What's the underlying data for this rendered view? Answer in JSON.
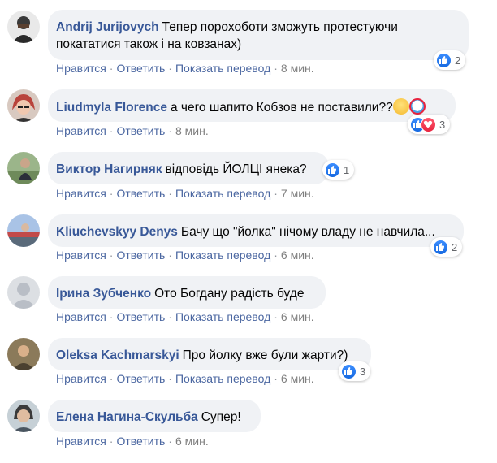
{
  "comments": [
    {
      "author": "Andrij Jurijovych",
      "lines": [
        "Тепер порохоботи зможуть протестуючи",
        "покататися також і на ковзанах)"
      ],
      "actions": {
        "like": "Нравится",
        "reply": "Ответить",
        "translate": "Показать перевод",
        "time": "8 мин."
      },
      "reactions": {
        "types": [
          "like"
        ],
        "count": "2"
      },
      "avatar_color": "#3a3a3a"
    },
    {
      "author": "Liudmyla Florence",
      "lines": [
        "а чего шапито Кобзов не поставили??"
      ],
      "emojis": [
        "worried-face",
        "clown-face"
      ],
      "actions": {
        "like": "Нравится",
        "reply": "Ответить",
        "time": "8 мин."
      },
      "reactions": {
        "types": [
          "like",
          "love"
        ],
        "count": "3"
      },
      "avatar_color": "#b9443c"
    },
    {
      "author": "Виктор Нагирняк",
      "lines": [
        "відповідь ЙОЛЦІ янека?"
      ],
      "actions": {
        "like": "Нравится",
        "reply": "Ответить",
        "translate": "Показать перевод",
        "time": "7 мин."
      },
      "reactions": {
        "types": [
          "like"
        ],
        "count": "1"
      },
      "avatar_color": "#6e8a5a"
    },
    {
      "author": "Kliuchevskyy Denys",
      "lines": [
        "Бачу що \"йолка\" нічому владу не навчила..."
      ],
      "actions": {
        "like": "Нравится",
        "reply": "Ответить",
        "translate": "Показать перевод",
        "time": "6 мин."
      },
      "reactions": {
        "types": [
          "like"
        ],
        "count": "2"
      },
      "avatar_color": "#7d92b8"
    },
    {
      "author": "Ірина Зубченко",
      "lines": [
        "Ото Богдану радість буде"
      ],
      "actions": {
        "like": "Нравится",
        "reply": "Ответить",
        "translate": "Показать перевод",
        "time": "6 мин."
      },
      "avatar_color": "#c7ccd4"
    },
    {
      "author": "Oleksa Kachmarskyi",
      "lines": [
        "Про йолку вже були жарти?)"
      ],
      "actions": {
        "like": "Нравится",
        "reply": "Ответить",
        "translate": "Показать перевод",
        "time": "6 мин."
      },
      "reactions": {
        "types": [
          "like"
        ],
        "count": "3"
      },
      "avatar_color": "#6b5a3a"
    },
    {
      "author": "Елена Нагина-Скульба",
      "lines": [
        "Супер!"
      ],
      "actions": {
        "like": "Нравится",
        "reply": "Ответить",
        "time": "6 мин."
      },
      "avatar_color": "#4a5560"
    }
  ],
  "colors": {
    "bubble": "#f0f2f5",
    "author": "#385898",
    "link": "#4b67a1",
    "like": "#1877f2"
  }
}
